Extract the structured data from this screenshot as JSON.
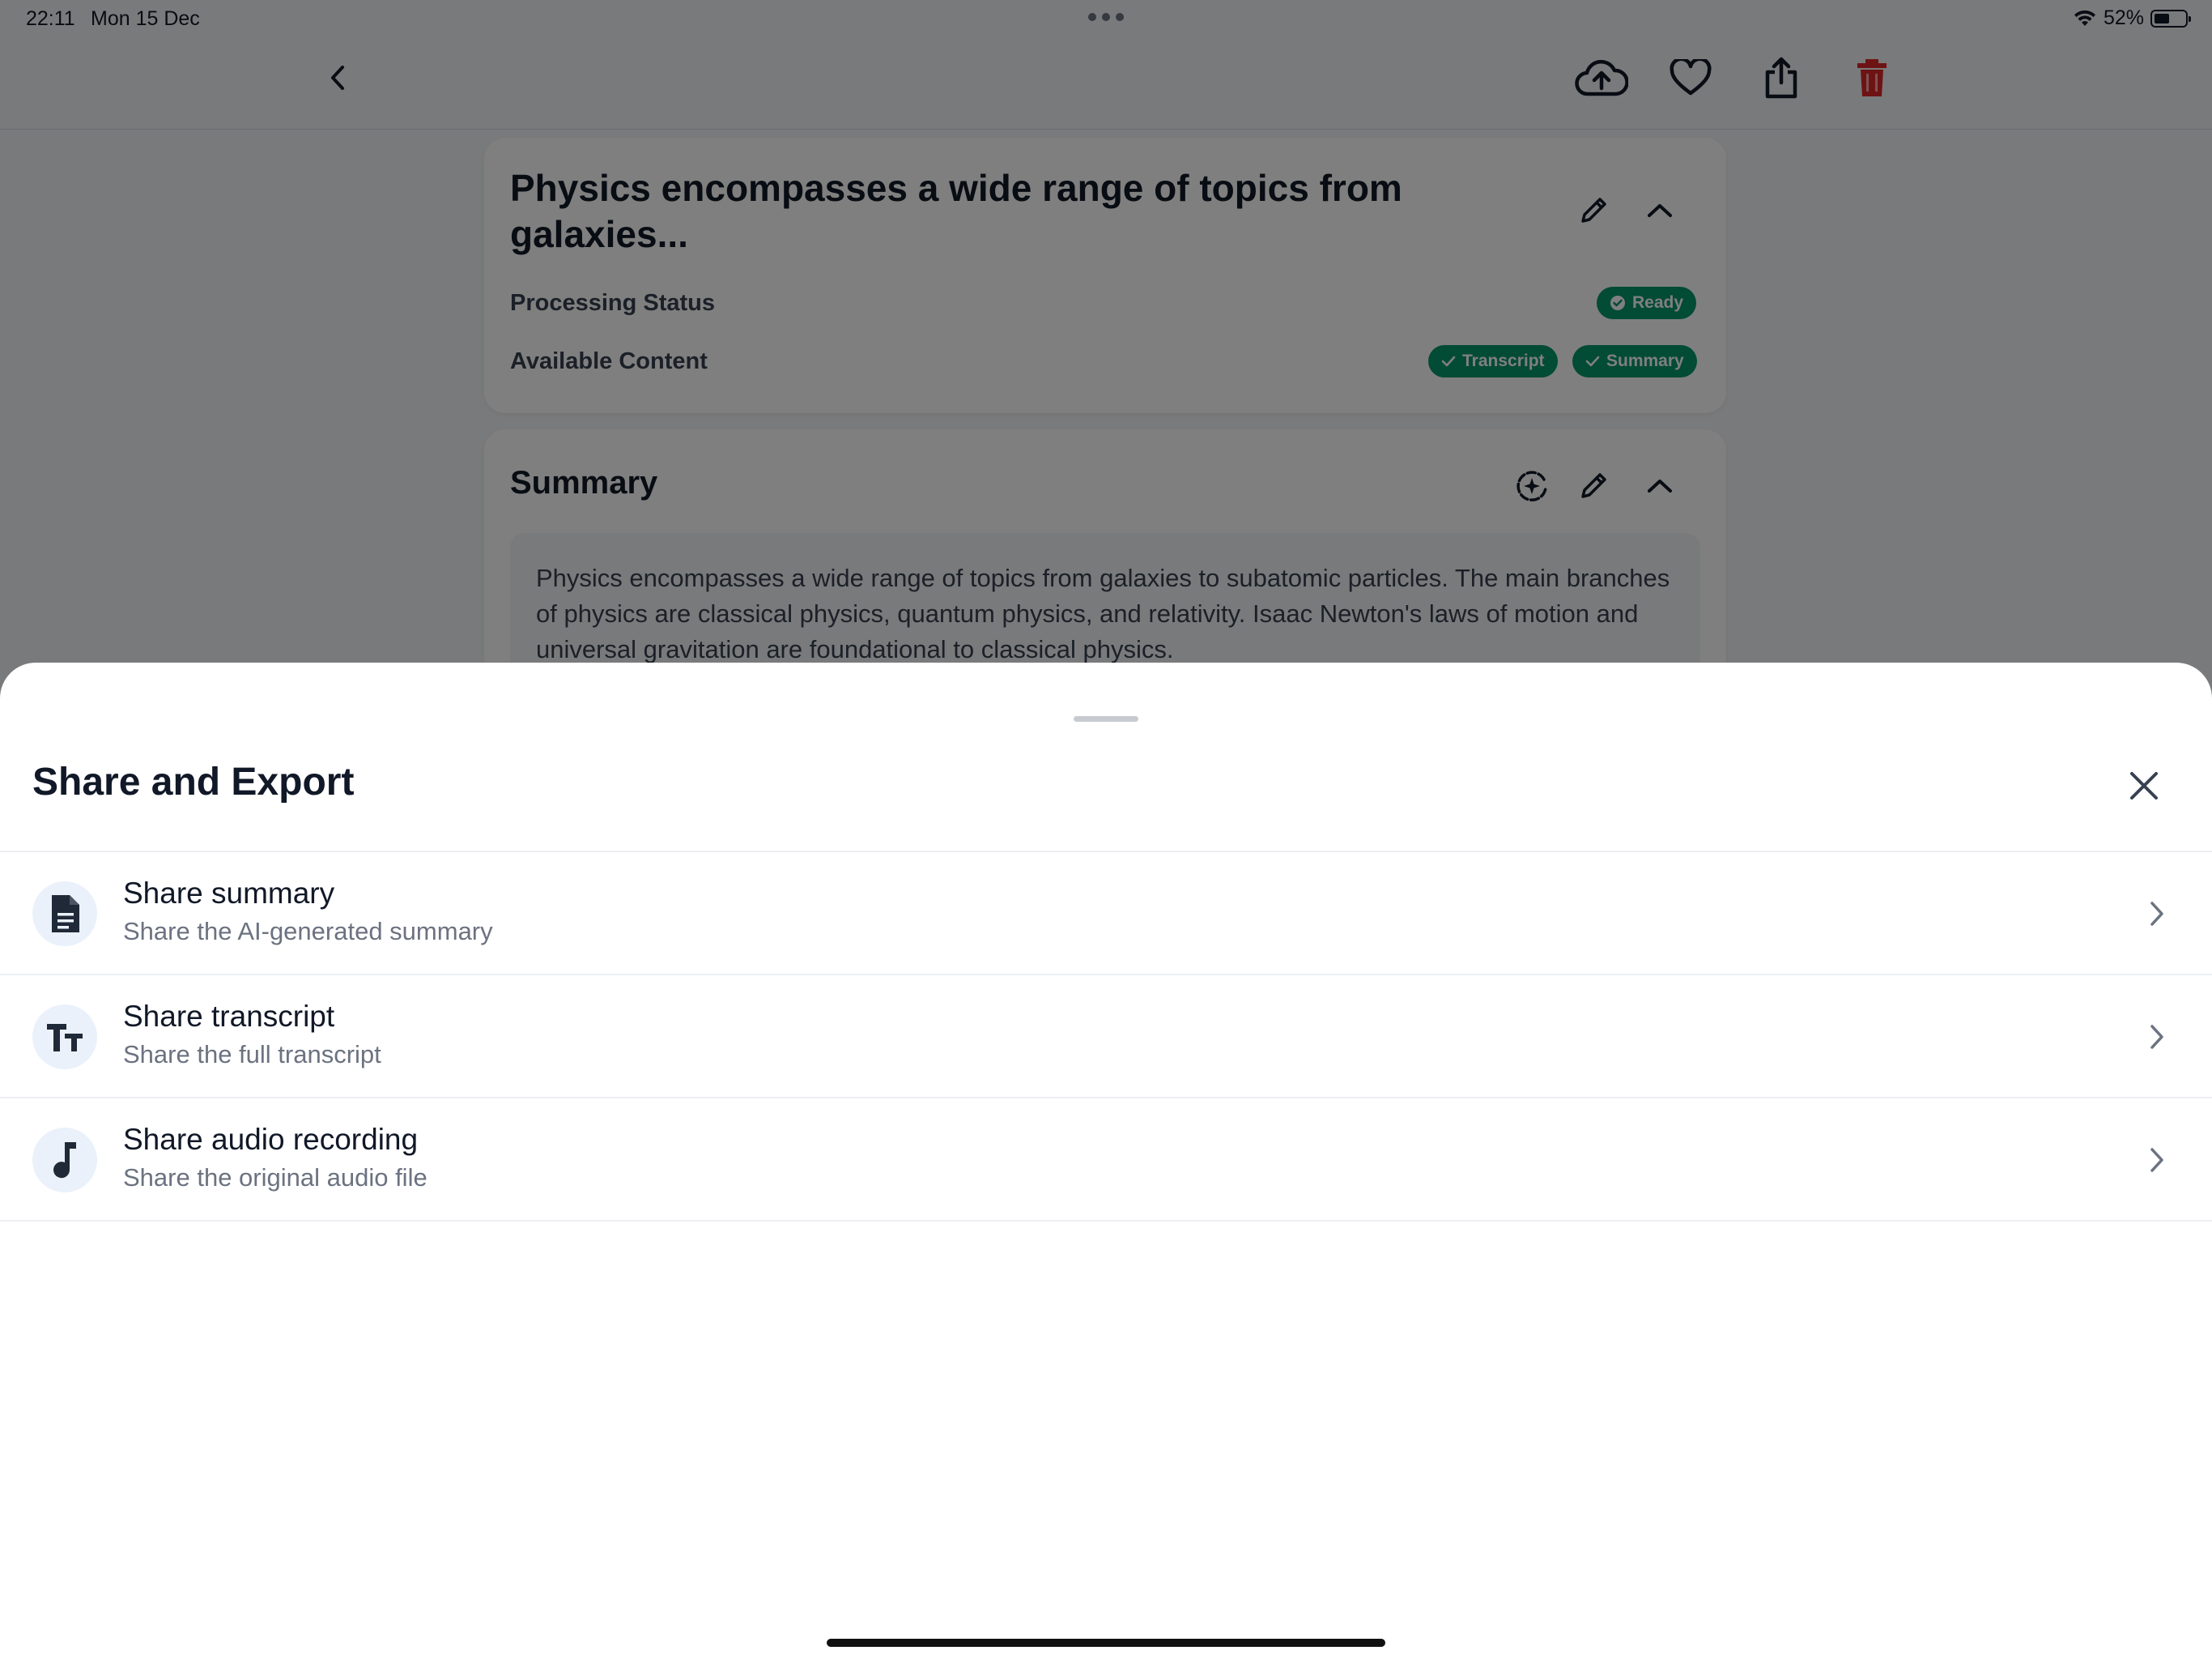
{
  "status_bar": {
    "time": "22:11",
    "date": "Mon 15 Dec",
    "battery": "52%",
    "battery_level": 0.52,
    "icons": [
      "multitasking-dots-icon",
      "wifi-icon",
      "battery-icon"
    ]
  },
  "toolbar": {
    "icons": [
      "back-chevron-icon",
      "cloud-upload-icon",
      "heart-icon",
      "share-icon",
      "trash-icon"
    ],
    "colors": {
      "delete": "#dc2626",
      "default": "#111827"
    }
  },
  "recording_card": {
    "title": "Physics encompasses a wide range of topics from galaxies...",
    "processing_label": "Processing Status",
    "status_badge": "Ready",
    "available_label": "Available Content",
    "content_badges": [
      "Transcript",
      "Summary"
    ],
    "badge_color": "#059669"
  },
  "summary_card": {
    "heading": "Summary",
    "text": "Physics encompasses a wide range of topics from galaxies to subatomic particles. The main branches of physics are classical physics, quantum physics, and relativity. Isaac Newton's laws of motion and universal gravitation are foundational to classical physics."
  },
  "share_sheet": {
    "title": "Share and Export",
    "items": [
      {
        "title": "Share summary",
        "subtitle": "Share the AI-generated summary",
        "icon": "document-icon"
      },
      {
        "title": "Share transcript",
        "subtitle": "Share the full transcript",
        "icon": "text-size-icon"
      },
      {
        "title": "Share audio recording",
        "subtitle": "Share the original audio file",
        "icon": "music-note-icon"
      }
    ]
  }
}
